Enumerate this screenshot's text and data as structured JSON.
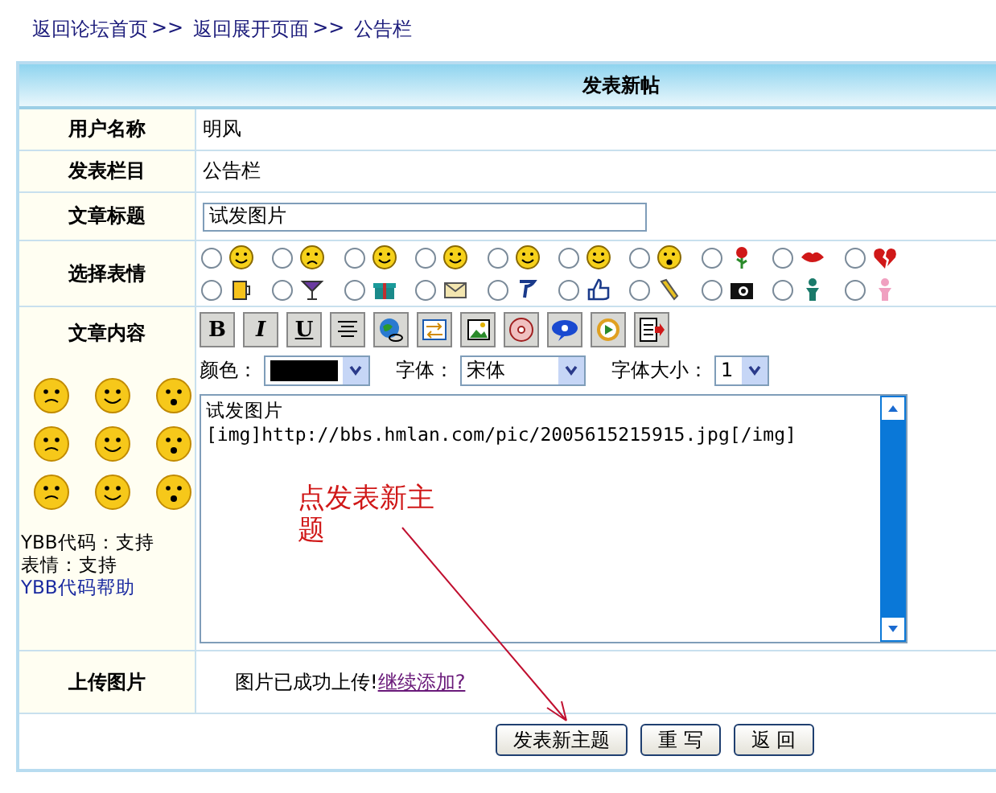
{
  "breadcrumb": [
    {
      "label": "返回论坛首页"
    },
    {
      "label": "返回展开页面"
    },
    {
      "label": "公告栏"
    }
  ],
  "breadcrumb_separator": ">>",
  "form_title": "发表新帖",
  "rows": [
    {
      "label": "用户名称",
      "value": "明风"
    },
    {
      "label": "发表栏目",
      "value": "公告栏"
    }
  ],
  "title_field": {
    "label": "文章标题",
    "value": "试发图片"
  },
  "emotions": {
    "label": "选择表情",
    "options": [
      {
        "selected": false
      },
      {
        "selected": false
      },
      {
        "selected": false
      },
      {
        "selected": false
      },
      {
        "selected": false
      },
      {
        "selected": false
      },
      {
        "selected": false
      },
      {
        "selected": false
      },
      {
        "selected": false
      },
      {
        "selected": false
      },
      {
        "selected": false
      },
      {
        "selected": false
      },
      {
        "selected": false
      },
      {
        "selected": false
      },
      {
        "selected": false
      },
      {
        "selected": false
      },
      {
        "selected": false
      },
      {
        "selected": false
      },
      {
        "selected": false
      },
      {
        "selected": false
      }
    ]
  },
  "content": {
    "label": "文章内容",
    "format_buttons": [
      "B",
      "I",
      "U"
    ],
    "color_label": "颜色：",
    "font_label": "字体：",
    "font_value": "宋体",
    "size_label": "字体大小：",
    "size_value": "1",
    "ybb_status": "YBB代码：支持",
    "emotion_status": "表情：支持",
    "help_link": "YBB代码帮助",
    "text": "试发图片\n[img]http://bbs.hmlan.com/pic/2005615215915.jpg[/img]"
  },
  "upload": {
    "label": "上传图片",
    "message": "图片已成功上传!",
    "link": "继续添加?"
  },
  "buttons": [
    "发表新主题",
    "重 写",
    "返 回"
  ],
  "annotation": "点发表新主题"
}
